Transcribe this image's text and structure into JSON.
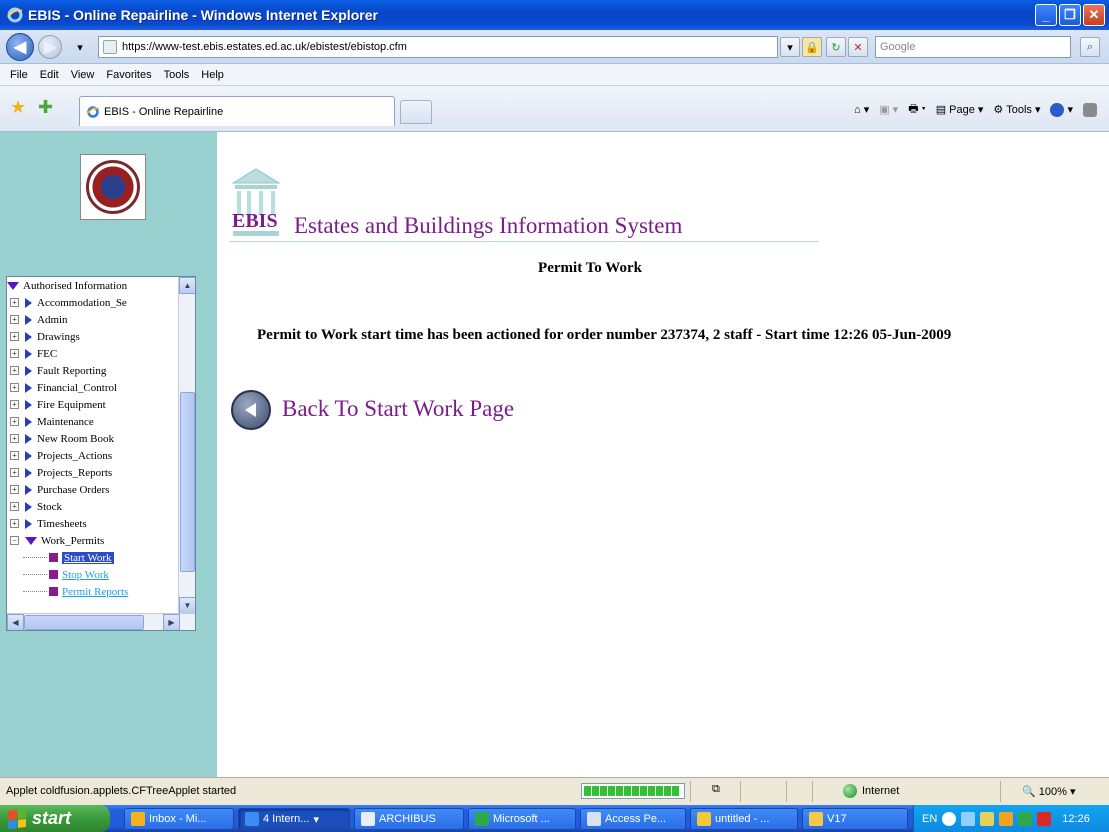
{
  "window": {
    "title": "EBIS - Online Repairline - Windows Internet Explorer"
  },
  "browser": {
    "address": "https://www-test.ebis.estates.ed.ac.uk/ebistest/ebistop.cfm",
    "search_placeholder": "Google",
    "menu": [
      "File",
      "Edit",
      "View",
      "Favorites",
      "Tools",
      "Help"
    ],
    "tab_title": "EBIS - Online Repairline",
    "commands": {
      "page": "Page",
      "tools": "Tools"
    }
  },
  "sidebar": {
    "tree_root": "Authorised Information",
    "items": [
      "Accommodation_Se",
      "Admin",
      "Drawings",
      "FEC",
      "Fault Reporting",
      "Financial_Control",
      "Fire Equipment",
      "Maintenance",
      "New Room Book",
      "Projects_Actions",
      "Projects_Reports",
      "Purchase Orders",
      "Stock",
      "Timesheets"
    ],
    "expanded_item": "Work_Permits",
    "children": [
      "Start Work",
      "Stop Work",
      "Permit Reports"
    ]
  },
  "main": {
    "logo_text": "EBIS",
    "system_title": "Estates and Buildings Information System",
    "heading": "Permit To Work",
    "message": "Permit to Work start time has been actioned for order number 237374, 2 staff - Start time 12:26 05-Jun-2009",
    "back_link": "Back To Start Work Page"
  },
  "statusbar": {
    "text": "Applet coldfusion.applets.CFTreeApplet started",
    "progress_percent": 100,
    "zone": "Internet",
    "zoom": "100%"
  },
  "taskbar": {
    "start": "start",
    "tasks": [
      "Inbox - Mi...",
      "4 Intern...",
      "ARCHIBUS",
      "Microsoft ...",
      "Access Pe...",
      "untitled - ...",
      "V17"
    ],
    "lang": "EN",
    "clock": "12:26"
  },
  "colors": {
    "sidebar_bg": "#98d0d0",
    "accent_purple": "#7c1c8c",
    "titlebar_blue": "#0747c6"
  }
}
